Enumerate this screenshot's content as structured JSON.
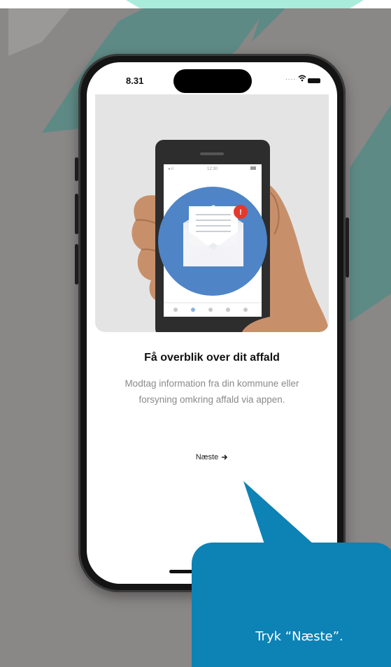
{
  "status_bar": {
    "time": "8.31",
    "signal_dots": "....",
    "icons": [
      "wifi-icon",
      "battery-icon"
    ]
  },
  "hero": {
    "illustration": "hand-holding-phone-with-envelope-notification",
    "inner_phone_status_time": "12:30",
    "notification_badge": "!",
    "colors": {
      "circle": "#4f85c7",
      "skin": "#c8906a",
      "badge": "#e23a2e",
      "panel": "#e4e4e4"
    }
  },
  "onboarding": {
    "title": "Få overblik over dit affald",
    "description": "Modtag information fra din kommune eller forsyning omkring affald via appen.",
    "next_label": "Næste",
    "next_icon": "arrow-right-icon"
  },
  "callout": {
    "text": "Tryk “Næste”.",
    "color": "#0d82b5"
  },
  "background": {
    "gray": "#8a8787",
    "teal": "#5e8a85"
  }
}
